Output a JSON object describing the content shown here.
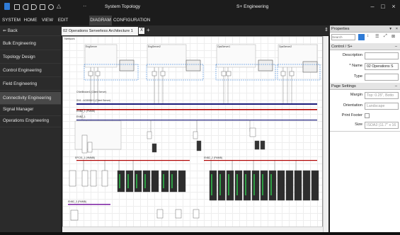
{
  "app": {
    "title": "S+ Engineering",
    "window_title": "System Topology",
    "menus": [
      "SYSTEM",
      "HOME",
      "VIEW",
      "EDIT",
      "DIAGRAM",
      "CONFIGURATION"
    ],
    "active_menu": "DIAGRAM"
  },
  "nav": {
    "back_label": "Back",
    "items": [
      "Bulk Engineering",
      "Topology Design",
      "Control Engineering",
      "Field Engineering",
      "Connectivity Engineering",
      "Signal Manager",
      "Operations Engineering"
    ],
    "selected": "Connectivity Engineering"
  },
  "document": {
    "tab_label": "02 Operations Serverless Architecture 1",
    "tab_close": "X",
    "tab_add": "+",
    "diagram_title": "Network"
  },
  "diagram": {
    "labels": [
      "EngServer",
      "EngServer2",
      "OpsServer1",
      "OpsServer2",
      "CNetBroker1 (Client Server)",
      "SN1 - AC800M 1 (Client Server)",
      "ENBZ_1 (FMMB)",
      "ENBZ_1",
      "EPC01_1 (HMMB)",
      "ENBZ_2 (FMMB)",
      "ENBZ_3 (FMMB)"
    ]
  },
  "properties": {
    "title": "Properties",
    "search_placeholder": "Search",
    "section_control": "Control / S+",
    "description_label": "Description",
    "description_value": "",
    "name_label": "* Name",
    "name_value": "02 Operations S",
    "type_label": "Type",
    "type_value": "",
    "section_page": "Page Settings",
    "margin_label": "Margin",
    "margin_value": "Top: 0.25\", Botto",
    "orientation_label": "Orientation",
    "orientation_value": "Landscape",
    "print_footer_label": "Print Footer",
    "size_label": "Size",
    "size_value": "ISOA3 (11.7\" x 16"
  },
  "colors": {
    "bus_navy": "#1b1b7a",
    "bus_red": "#b00000",
    "bus_purple": "#7b1fa2",
    "highlight_blue": "#1e73d8"
  }
}
